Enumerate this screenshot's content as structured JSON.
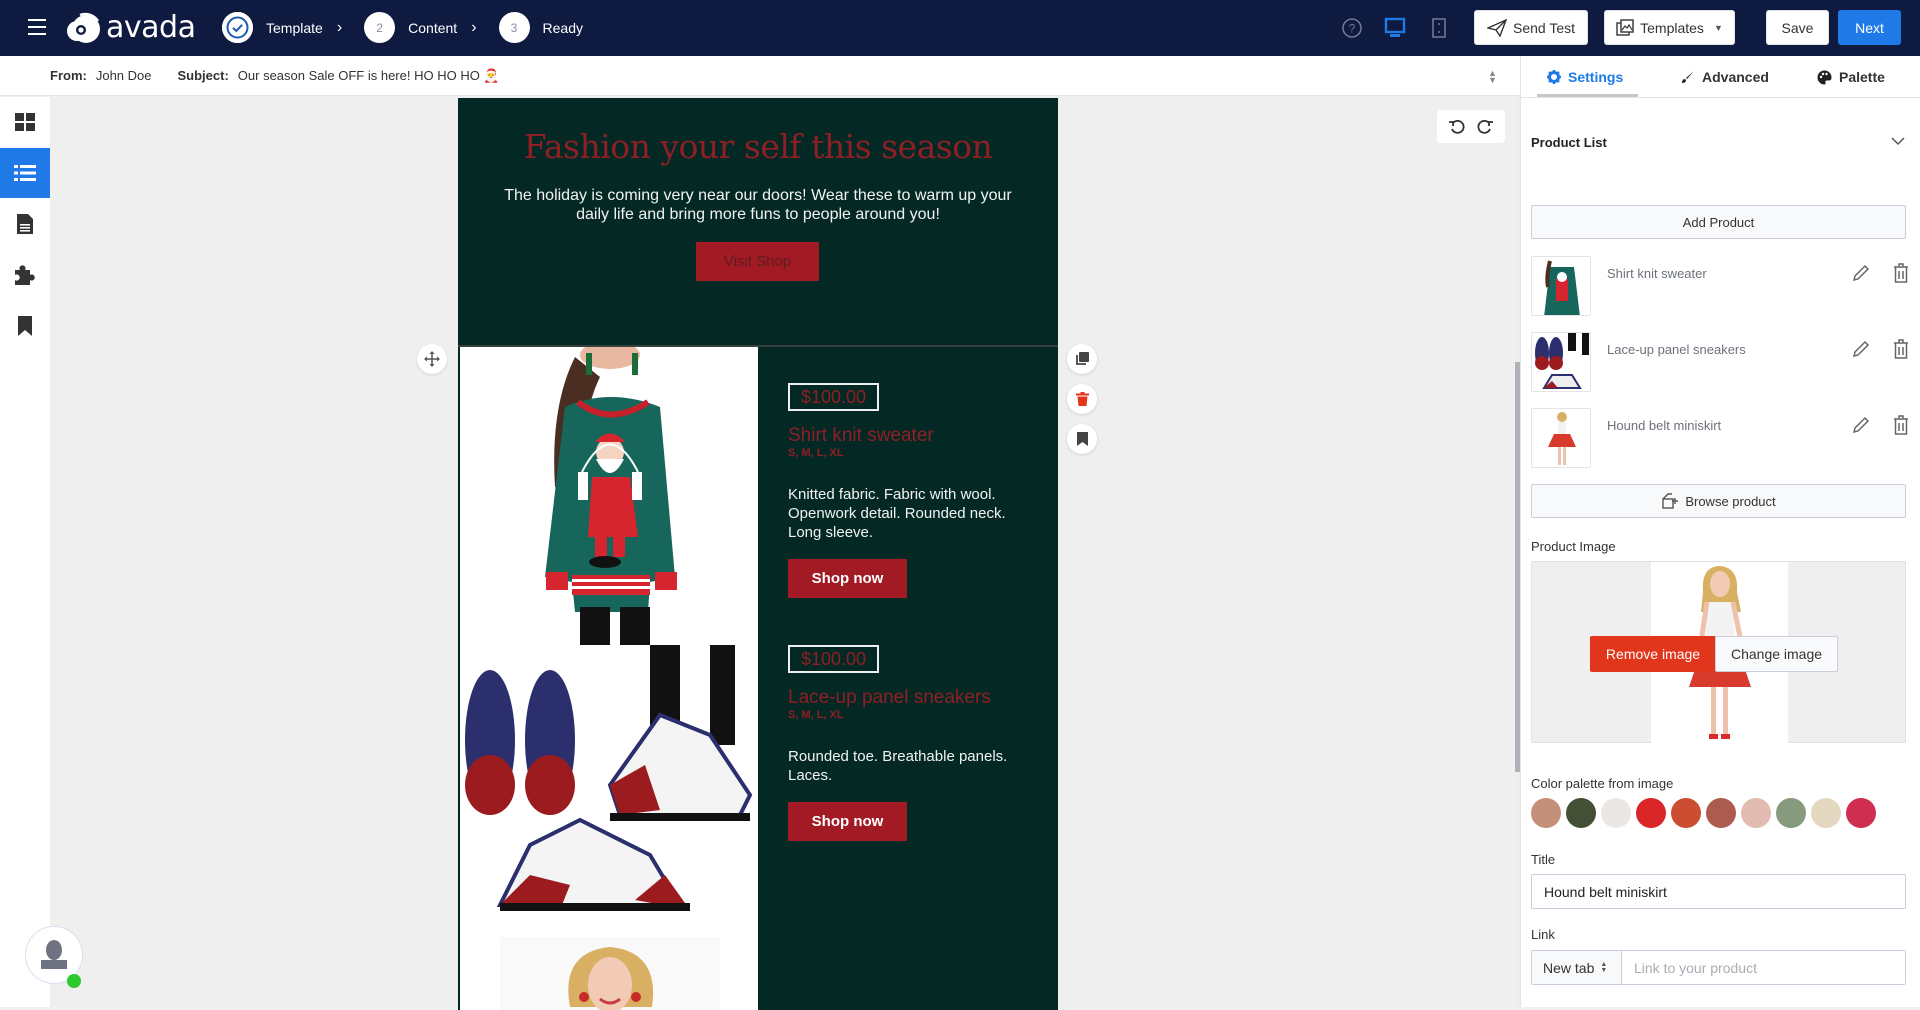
{
  "app": {
    "name": "avada"
  },
  "steps": [
    {
      "label": "Template",
      "number": "",
      "state": "done"
    },
    {
      "label": "Content",
      "number": "2",
      "state": "todo"
    },
    {
      "label": "Ready",
      "number": "3",
      "state": "todo"
    }
  ],
  "toolbar": {
    "send_test": "Send Test",
    "templates": "Templates",
    "save": "Save",
    "next": "Next",
    "icons": [
      "help-icon",
      "desktop-view-icon",
      "mobile-view-icon"
    ]
  },
  "email_meta": {
    "from_label": "From:",
    "from_value": "John Doe",
    "subject_label": "Subject:",
    "subject_value": "Our season Sale OFF is here! HO HO HO 🎅"
  },
  "left_nav": [
    "layout-grid-icon",
    "list-icon",
    "document-icon",
    "puzzle-icon",
    "bookmark-icon"
  ],
  "email": {
    "hero": {
      "title": "Fashion your self this season",
      "text": "The holiday is coming very near our doors! Wear these to warm up your daily life and bring more funs to people around you!",
      "button": "Visit Shop"
    },
    "products": [
      {
        "price": "$100.00",
        "name": "Shirt knit sweater",
        "sizes": "S, M, L, XL",
        "desc": "Knitted fabric. Fabric with wool. Openwork detail. Rounded neck. Long sleeve.",
        "button": "Shop now"
      },
      {
        "price": "$100.00",
        "name": "Lace-up panel sneakers",
        "sizes": "S, M, L, XL",
        "desc": "Rounded toe. Breathable panels. Laces.",
        "button": "Shop now"
      }
    ],
    "colors": {
      "background": "#042925",
      "accent": "#a11a24",
      "title": "#8f1f25"
    }
  },
  "panel": {
    "tabs": [
      {
        "label": "Settings",
        "icon": "gear-icon",
        "active": true
      },
      {
        "label": "Advanced",
        "icon": "brush-icon",
        "active": false
      },
      {
        "label": "Palette",
        "icon": "palette-icon",
        "active": false
      }
    ],
    "section_title": "Product List",
    "add_product": "Add Product",
    "product_list": [
      {
        "name": "Shirt knit sweater"
      },
      {
        "name": "Lace-up panel sneakers"
      },
      {
        "name": "Hound belt miniskirt"
      }
    ],
    "browse_product": "Browse product",
    "product_image_label": "Product Image",
    "remove_image": "Remove image",
    "change_image": "Change image",
    "palette_label": "Color palette from image",
    "palette": [
      "#c4907a",
      "#445036",
      "#ede7e4",
      "#db2627",
      "#cc4e32",
      "#ab5c4e",
      "#e2bcb0",
      "#869a7d",
      "#e5d8c1",
      "#cf2e50"
    ],
    "title_label": "Title",
    "title_value": "Hound belt miniskirt",
    "link_label": "Link",
    "link_target": "New tab",
    "link_placeholder": "Link to your product"
  },
  "colors": {
    "topbar": "#0e1a3f",
    "primary": "#1f7ae8",
    "danger": "#e1361b"
  }
}
